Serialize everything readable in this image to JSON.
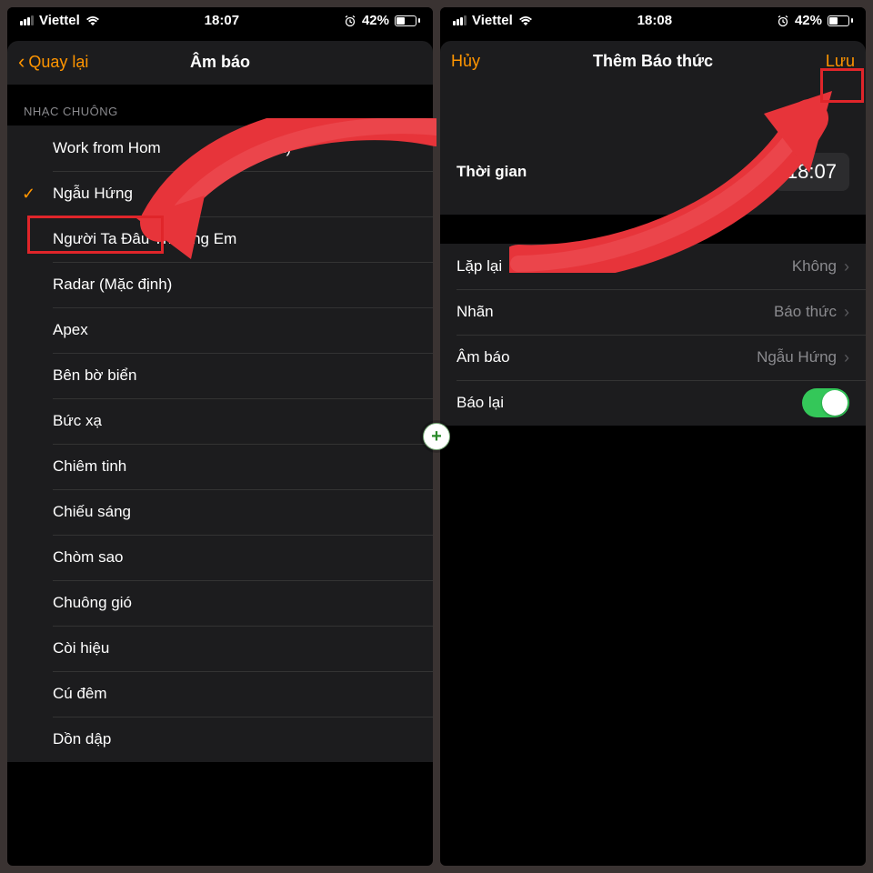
{
  "status": {
    "carrier": "Viettel",
    "battery_pct": "42%",
    "left_time": "18:07",
    "right_time": "18:08"
  },
  "left": {
    "back": "Quay lại",
    "title": "Âm báo",
    "section": "NHẠC CHUÔNG",
    "ringtones": [
      "Work from Hom",
      "Ngẫu Hứng",
      "Người Ta Đâu Thương Em",
      "Radar (Mặc định)",
      "Apex",
      "Bên bờ biển",
      "Bức xạ",
      "Chiêm tinh",
      "Chiếu sáng",
      "Chòm sao",
      "Chuông gió",
      "Còi hiệu",
      "Cú đêm",
      "Dồn dập"
    ],
    "ringtone_suffix": "a Remix)",
    "selected_index": 1
  },
  "right": {
    "cancel": "Hủy",
    "title": "Thêm Báo thức",
    "save": "Lưu",
    "time_label": "Thời gian",
    "time_value": "18:07",
    "rows": {
      "repeat_label": "Lặp lại",
      "repeat_value": "Không",
      "label_label": "Nhãn",
      "label_value": "Báo thức",
      "sound_label": "Âm báo",
      "sound_value": "Ngẫu Hứng",
      "snooze_label": "Báo lại"
    }
  },
  "icons": {
    "alarm": "⏰"
  }
}
